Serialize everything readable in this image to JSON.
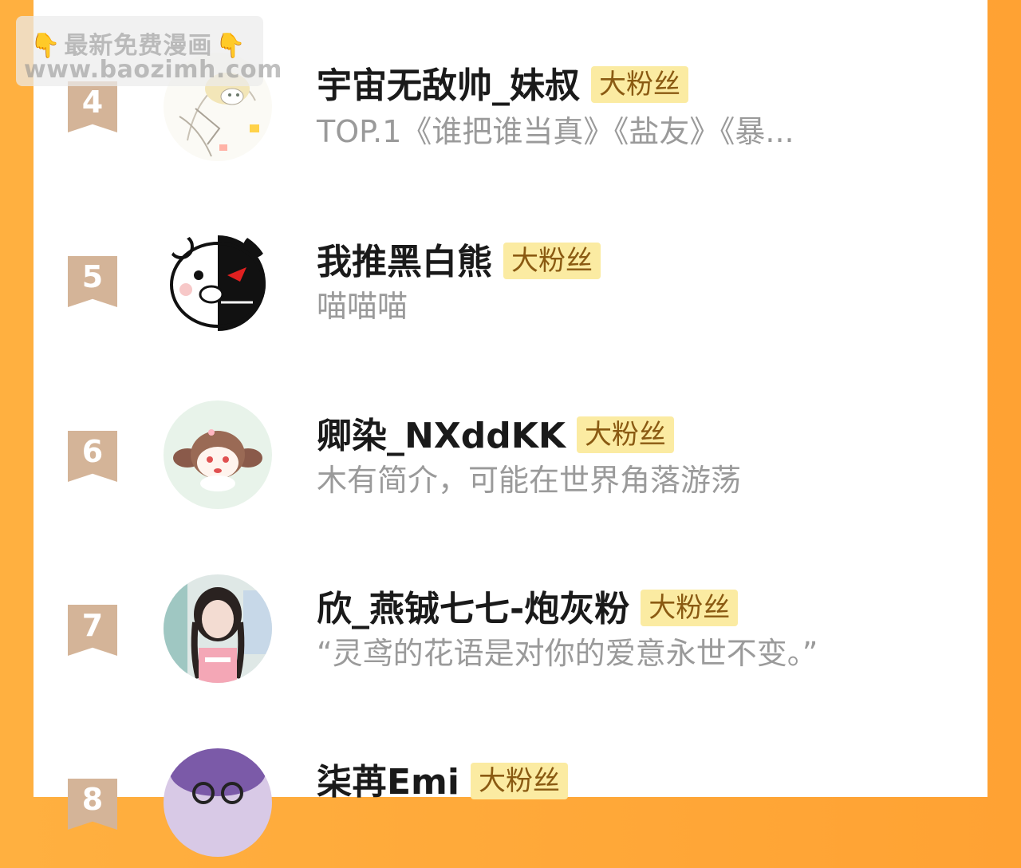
{
  "watermark": {
    "line1": "最新免费漫画",
    "line2": "www.baozimh.com",
    "hand_icon": "👇"
  },
  "colors": {
    "side_background": "#ffa233",
    "rank_ribbon": "#d4b498",
    "badge_bg": "#fbeba2",
    "badge_text": "#8a5a12",
    "description_text": "#9a9a9a"
  },
  "fans": [
    {
      "rank": "4",
      "name": "宇宙无敌帅_妹叔",
      "badge": "大粉丝",
      "description": "TOP.1《谁把谁当真》《盐友》《暴..."
    },
    {
      "rank": "5",
      "name": "我推黑白熊",
      "badge": "大粉丝",
      "description": "喵喵喵"
    },
    {
      "rank": "6",
      "name": "卿染_NXddKK",
      "badge": "大粉丝",
      "description": "木有简介，可能在世界角落游荡"
    },
    {
      "rank": "7",
      "name": "欣_燕铖七七-炮灰粉",
      "badge": "大粉丝",
      "description": "“灵鸢的花语是对你的爱意永世不变。”"
    },
    {
      "rank": "8",
      "name": "柒苒Emi",
      "badge": "大粉丝",
      "description": ""
    }
  ]
}
